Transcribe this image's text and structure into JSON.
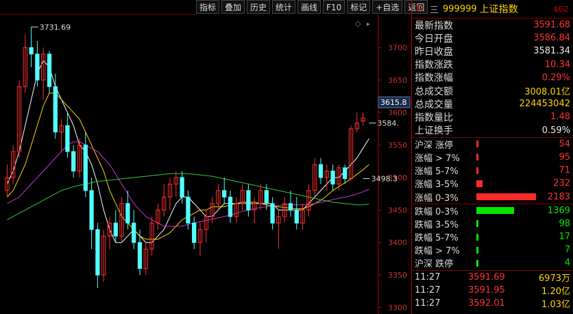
{
  "toolbar": [
    "指标",
    "叠加",
    "历史",
    "统计",
    "画线",
    "F10",
    "标记",
    "+自选",
    "返回"
  ],
  "header": {
    "market": "G",
    "separator": "三",
    "code": "999999",
    "name": "上证指数",
    "tag": "$G2"
  },
  "quote": [
    {
      "label": "最新指数",
      "value": "3591.68",
      "color": "red"
    },
    {
      "label": "今日开盘",
      "value": "3586.84",
      "color": "red"
    },
    {
      "label": "昨日收盘",
      "value": "3581.34",
      "color": "white"
    },
    {
      "label": "指数涨跌",
      "value": "10.34",
      "color": "red"
    },
    {
      "label": "指数涨幅",
      "value": "0.29%",
      "color": "red"
    },
    {
      "label": "总成交额",
      "value": "3008.01亿",
      "color": "yellow"
    },
    {
      "label": "总成交量",
      "value": "224453042",
      "color": "yellow"
    },
    {
      "label": "指数量比",
      "value": "1.48",
      "color": "red"
    },
    {
      "label": "上证换手",
      "value": "0.59%",
      "color": "white"
    }
  ],
  "breadth_up": [
    {
      "label": "沪深 涨停",
      "value": "54",
      "color": "red",
      "fraction": 0.02
    },
    {
      "label": "涨幅 > 7%",
      "value": "95",
      "color": "red",
      "fraction": 0.03
    },
    {
      "label": "涨幅 5-7%",
      "value": "71",
      "color": "red",
      "fraction": 0.025
    },
    {
      "label": "涨幅 3-5%",
      "value": "232",
      "color": "red",
      "fraction": 0.1
    },
    {
      "label": "涨幅 0-3%",
      "value": "2183",
      "color": "red",
      "fraction": 1.0
    }
  ],
  "breadth_down": [
    {
      "label": "跌幅 0-3%",
      "value": "1369",
      "color": "green",
      "fraction": 0.63
    },
    {
      "label": "跌幅 3-5%",
      "value": "98",
      "color": "green",
      "fraction": 0.04
    },
    {
      "label": "跌幅 5-7%",
      "value": "17",
      "color": "green",
      "fraction": 0.01
    },
    {
      "label": "跌幅 > 7%",
      "value": "7",
      "color": "green",
      "fraction": 0.01
    },
    {
      "label": "沪深 跌停",
      "value": "4",
      "color": "green",
      "fraction": 0.01
    }
  ],
  "ticks": [
    {
      "time": "11:27",
      "price": "3591.69",
      "volume": "6973万"
    },
    {
      "time": "11:27",
      "price": "3591.95",
      "volume": "1.20亿"
    },
    {
      "time": "11:27",
      "price": "3592.01",
      "volume": "1.03亿"
    }
  ],
  "chart_data": {
    "type": "candlestick",
    "y_axis": [
      3300,
      3350,
      3400,
      3450,
      3500,
      3550,
      3600,
      3650,
      3700
    ],
    "ylim": [
      3290,
      3750
    ],
    "current_price_label": "3615.8",
    "annotations": [
      {
        "text": "3731.69",
        "value": 3731.69,
        "index": 4
      },
      {
        "text": "3584.",
        "value": 3584,
        "index": 60
      },
      {
        "text": "3498.3",
        "value": 3498.3,
        "index": 59
      }
    ],
    "candles": [
      {
        "o": 3480,
        "h": 3520,
        "l": 3470,
        "c": 3500
      },
      {
        "o": 3500,
        "h": 3550,
        "l": 3490,
        "c": 3540
      },
      {
        "o": 3540,
        "h": 3650,
        "l": 3530,
        "c": 3640
      },
      {
        "o": 3640,
        "h": 3720,
        "l": 3630,
        "c": 3700
      },
      {
        "o": 3700,
        "h": 3731.69,
        "l": 3670,
        "c": 3690
      },
      {
        "o": 3690,
        "h": 3710,
        "l": 3640,
        "c": 3650
      },
      {
        "o": 3650,
        "h": 3700,
        "l": 3620,
        "c": 3690
      },
      {
        "o": 3690,
        "h": 3695,
        "l": 3630,
        "c": 3640
      },
      {
        "o": 3640,
        "h": 3660,
        "l": 3560,
        "c": 3570
      },
      {
        "o": 3570,
        "h": 3590,
        "l": 3540,
        "c": 3580
      },
      {
        "o": 3580,
        "h": 3600,
        "l": 3530,
        "c": 3540
      },
      {
        "o": 3540,
        "h": 3550,
        "l": 3500,
        "c": 3510
      },
      {
        "o": 3510,
        "h": 3560,
        "l": 3500,
        "c": 3550
      },
      {
        "o": 3550,
        "h": 3570,
        "l": 3470,
        "c": 3480
      },
      {
        "o": 3480,
        "h": 3500,
        "l": 3390,
        "c": 3420
      },
      {
        "o": 3420,
        "h": 3430,
        "l": 3330,
        "c": 3350
      },
      {
        "o": 3350,
        "h": 3420,
        "l": 3340,
        "c": 3410
      },
      {
        "o": 3410,
        "h": 3440,
        "l": 3390,
        "c": 3430
      },
      {
        "o": 3430,
        "h": 3450,
        "l": 3400,
        "c": 3410
      },
      {
        "o": 3410,
        "h": 3470,
        "l": 3400,
        "c": 3460
      },
      {
        "o": 3460,
        "h": 3480,
        "l": 3420,
        "c": 3430
      },
      {
        "o": 3430,
        "h": 3450,
        "l": 3390,
        "c": 3400
      },
      {
        "o": 3400,
        "h": 3420,
        "l": 3350,
        "c": 3360
      },
      {
        "o": 3360,
        "h": 3400,
        "l": 3350,
        "c": 3390
      },
      {
        "o": 3390,
        "h": 3440,
        "l": 3380,
        "c": 3430
      },
      {
        "o": 3430,
        "h": 3460,
        "l": 3420,
        "c": 3450
      },
      {
        "o": 3450,
        "h": 3490,
        "l": 3440,
        "c": 3470
      },
      {
        "o": 3470,
        "h": 3500,
        "l": 3450,
        "c": 3490
      },
      {
        "o": 3490,
        "h": 3510,
        "l": 3470,
        "c": 3500
      },
      {
        "o": 3500,
        "h": 3510,
        "l": 3460,
        "c": 3470
      },
      {
        "o": 3470,
        "h": 3480,
        "l": 3420,
        "c": 3430
      },
      {
        "o": 3430,
        "h": 3440,
        "l": 3390,
        "c": 3400
      },
      {
        "o": 3400,
        "h": 3430,
        "l": 3380,
        "c": 3420
      },
      {
        "o": 3420,
        "h": 3450,
        "l": 3400,
        "c": 3440
      },
      {
        "o": 3440,
        "h": 3470,
        "l": 3430,
        "c": 3460
      },
      {
        "o": 3460,
        "h": 3490,
        "l": 3450,
        "c": 3480
      },
      {
        "o": 3480,
        "h": 3500,
        "l": 3460,
        "c": 3470
      },
      {
        "o": 3470,
        "h": 3480,
        "l": 3430,
        "c": 3440
      },
      {
        "o": 3440,
        "h": 3470,
        "l": 3430,
        "c": 3460
      },
      {
        "o": 3460,
        "h": 3490,
        "l": 3450,
        "c": 3480
      },
      {
        "o": 3480,
        "h": 3490,
        "l": 3440,
        "c": 3450
      },
      {
        "o": 3450,
        "h": 3470,
        "l": 3430,
        "c": 3460
      },
      {
        "o": 3460,
        "h": 3490,
        "l": 3450,
        "c": 3480
      },
      {
        "o": 3480,
        "h": 3490,
        "l": 3450,
        "c": 3460
      },
      {
        "o": 3460,
        "h": 3470,
        "l": 3420,
        "c": 3430
      },
      {
        "o": 3430,
        "h": 3450,
        "l": 3390,
        "c": 3440
      },
      {
        "o": 3440,
        "h": 3470,
        "l": 3430,
        "c": 3460
      },
      {
        "o": 3460,
        "h": 3480,
        "l": 3440,
        "c": 3450
      },
      {
        "o": 3450,
        "h": 3470,
        "l": 3420,
        "c": 3430
      },
      {
        "o": 3430,
        "h": 3460,
        "l": 3420,
        "c": 3450
      },
      {
        "o": 3450,
        "h": 3490,
        "l": 3440,
        "c": 3480
      },
      {
        "o": 3480,
        "h": 3530,
        "l": 3470,
        "c": 3520
      },
      {
        "o": 3520,
        "h": 3530,
        "l": 3490,
        "c": 3500
      },
      {
        "o": 3500,
        "h": 3520,
        "l": 3480,
        "c": 3510
      },
      {
        "o": 3510,
        "h": 3520,
        "l": 3480,
        "c": 3490
      },
      {
        "o": 3490,
        "h": 3520,
        "l": 3480,
        "c": 3515
      },
      {
        "o": 3515,
        "h": 3520,
        "l": 3490,
        "c": 3498.3
      },
      {
        "o": 3498.3,
        "h": 3580,
        "l": 3495,
        "c": 3575
      },
      {
        "o": 3575,
        "h": 3600,
        "l": 3570,
        "c": 3584
      },
      {
        "o": 3586.84,
        "h": 3600,
        "l": 3580,
        "c": 3591.68
      }
    ],
    "ma": [
      {
        "name": "MA5",
        "color": "#ffffff",
        "values": [
          3490,
          3510,
          3540,
          3580,
          3620,
          3660,
          3680,
          3670,
          3640,
          3620,
          3600,
          3580,
          3550,
          3540,
          3520,
          3490,
          3450,
          3420,
          3400,
          3400,
          3410,
          3420,
          3410,
          3400,
          3400,
          3410,
          3420,
          3440,
          3460,
          3470,
          3470,
          3460,
          3450,
          3440,
          3440,
          3450,
          3460,
          3460,
          3460,
          3460,
          3460,
          3460,
          3460,
          3460,
          3460,
          3450,
          3450,
          3450,
          3450,
          3450,
          3460,
          3470,
          3480,
          3490,
          3500,
          3500,
          3510,
          3520,
          3530,
          3545,
          3560
        ]
      },
      {
        "name": "MA10",
        "color": "#ffd700",
        "values": [
          3470,
          3480,
          3500,
          3520,
          3550,
          3580,
          3610,
          3630,
          3630,
          3620,
          3610,
          3600,
          3590,
          3570,
          3550,
          3530,
          3510,
          3480,
          3460,
          3440,
          3430,
          3420,
          3410,
          3405,
          3405,
          3405,
          3410,
          3415,
          3425,
          3435,
          3440,
          3445,
          3450,
          3450,
          3455,
          3455,
          3455,
          3458,
          3460,
          3462,
          3462,
          3462,
          3460,
          3458,
          3456,
          3455,
          3454,
          3453,
          3452,
          3452,
          3455,
          3460,
          3465,
          3472,
          3480,
          3486,
          3492,
          3498,
          3505,
          3512,
          3520
        ]
      },
      {
        "name": "MA20",
        "color": "#cc33cc",
        "values": [
          3460,
          3465,
          3470,
          3480,
          3490,
          3500,
          3510,
          3520,
          3530,
          3540,
          3550,
          3555,
          3555,
          3550,
          3545,
          3540,
          3530,
          3520,
          3505,
          3490,
          3475,
          3460,
          3450,
          3440,
          3435,
          3430,
          3425,
          3425,
          3425,
          3425,
          3428,
          3430,
          3432,
          3434,
          3436,
          3438,
          3440,
          3442,
          3445,
          3448,
          3450,
          3452,
          3454,
          3455,
          3456,
          3457,
          3458,
          3458,
          3458,
          3458,
          3458,
          3460,
          3462,
          3464,
          3466,
          3468,
          3470,
          3472,
          3475,
          3478,
          3482
        ]
      },
      {
        "name": "MA60",
        "color": "#33cc33",
        "values": [
          3435,
          3440,
          3445,
          3450,
          3455,
          3460,
          3465,
          3470,
          3475,
          3480,
          3483,
          3486,
          3488,
          3490,
          3492,
          3494,
          3495,
          3496,
          3497,
          3498,
          3499,
          3500,
          3501,
          3502,
          3503,
          3504,
          3505,
          3506,
          3506,
          3506,
          3506,
          3505,
          3504,
          3503,
          3502,
          3500,
          3498,
          3496,
          3494,
          3492,
          3490,
          3488,
          3486,
          3484,
          3482,
          3480,
          3478,
          3476,
          3474,
          3472,
          3470,
          3468,
          3466,
          3464,
          3462,
          3461,
          3460,
          3459,
          3458,
          3458,
          3459
        ]
      }
    ]
  }
}
